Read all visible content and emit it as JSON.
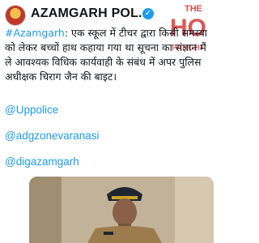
{
  "account": {
    "name": "AZAMGARH POL...",
    "verified_mark": "✓",
    "menu_glyph": "⋯"
  },
  "tweet": {
    "hashtag": "#Azamgarh",
    "text": ": एक स्कूल में टीचर द्वारा किसी समस्या को लेकर बच्चों हाथ कहाया गया था सूचना का संज्ञान मैं ले आवश्यक विधिक कार्यवाही के संबंध में अपर पुलिस अधीक्षक चिराग जैन की बाइट।",
    "mentions": [
      "@Uppolice",
      "@adgzonevaranasi",
      "@digazamgarh"
    ]
  },
  "watermark": {
    "line1": "THE",
    "line2": "HO",
    "line3": "PANCHI"
  },
  "icons": {
    "avatar": "police-emblem-avatar",
    "verified": "verified-badge-icon",
    "menu": "more-icon"
  },
  "colors": {
    "link": "#1d9bf0",
    "watermark": "#d32f2f"
  }
}
